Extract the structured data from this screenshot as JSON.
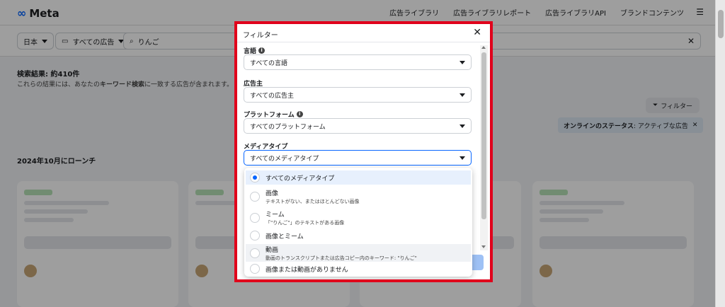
{
  "brand": {
    "name": "Meta"
  },
  "nav": {
    "items": [
      "広告ライブラリ",
      "広告ライブラリレポート",
      "広告ライブラリAPI",
      "ブランドコンテンツ"
    ]
  },
  "search": {
    "country": "日本",
    "ad_type": "すべての広告",
    "query": "りんご"
  },
  "results": {
    "count_label": "検索結果: 約410件",
    "subtitle_prefix": "これらの結果には、あなたの",
    "subtitle_keyword": "キーワード検索",
    "subtitle_suffix": "に一致する広告が含まれます。",
    "filter_button": "フィルター",
    "status_chip_bold": "オンラインのステータス",
    "status_chip_value": ": アクティブな広告",
    "launch_heading": "2024年10月にローンチ"
  },
  "modal": {
    "title": "フィルター",
    "fields": [
      {
        "label": "言語",
        "value": "すべての言語",
        "has_info": true
      },
      {
        "label": "広告主",
        "value": "すべての広告主",
        "has_info": false
      },
      {
        "label": "プラットフォーム",
        "value": "すべてのプラットフォーム",
        "has_info": true
      },
      {
        "label": "メディアタイプ",
        "value": "すべてのメディアタイプ",
        "has_info": false
      }
    ],
    "media_options": [
      {
        "label": "すべてのメディアタイプ",
        "desc": "",
        "selected": true
      },
      {
        "label": "画像",
        "desc": "テキストがない、またはほとんどない画像",
        "selected": false
      },
      {
        "label": "ミーム",
        "desc": "「\"りんご\"」のテキストがある画像",
        "selected": false
      },
      {
        "label": "画像とミーム",
        "desc": "",
        "selected": false
      },
      {
        "label": "動画",
        "desc": "動画のトランスクリプトまたは広告コピー内のキーワード: \"りんご\"",
        "selected": false
      },
      {
        "label": "画像または動画がありません",
        "desc": "",
        "selected": false
      }
    ]
  },
  "colors": {
    "accent": "#0866ff",
    "highlight_frame": "#e0001b"
  }
}
